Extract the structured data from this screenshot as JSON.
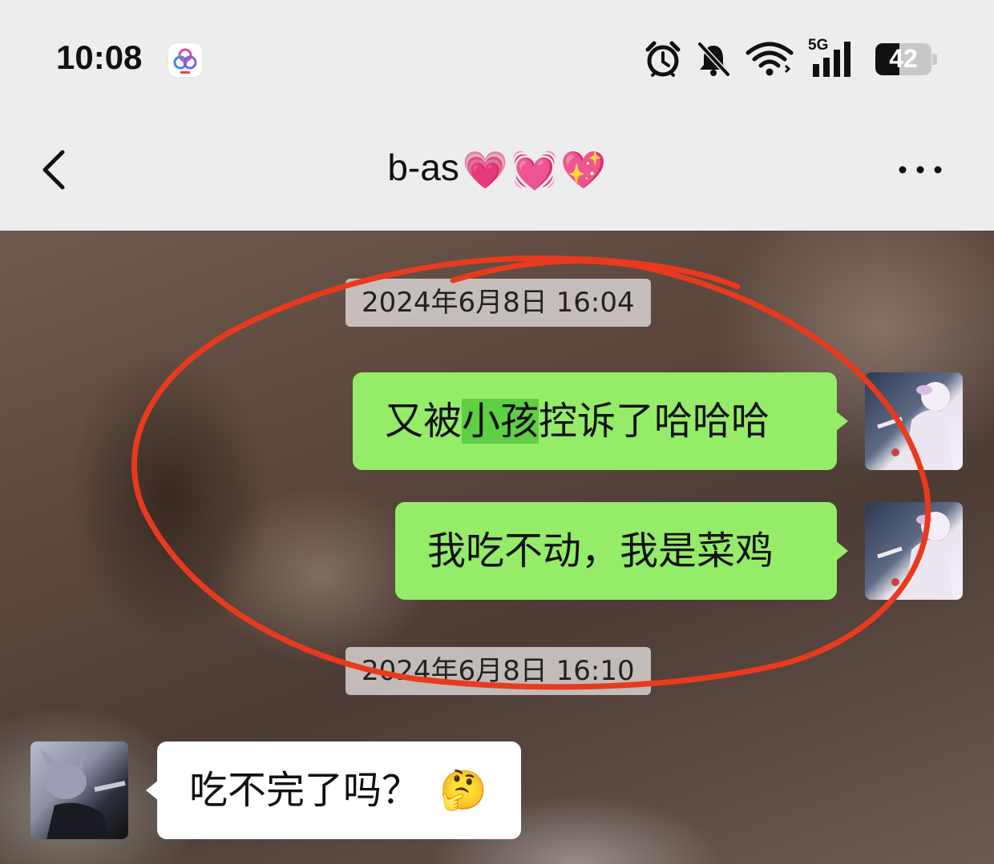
{
  "status_bar": {
    "time": "10:08",
    "app_icon": "multi-circle-app-icon",
    "icons": [
      "alarm-icon",
      "bell-off-icon",
      "wifi-icon",
      "cellular-5g-icon"
    ],
    "network_label": "5G",
    "battery_level": "42"
  },
  "header": {
    "back_icon": "chevron-left-icon",
    "title": "b-as",
    "title_emojis": [
      "💗",
      "💓",
      "💖"
    ],
    "more_icon": "more-dots-icon"
  },
  "messages": [
    {
      "type": "time",
      "text": "2024年6月8日 16:04"
    },
    {
      "type": "outgoing",
      "parts": [
        "又被",
        "小孩",
        "控诉了哈哈哈"
      ],
      "highlighted": "小孩"
    },
    {
      "type": "outgoing",
      "text": "我吃不动，我是菜鸡"
    },
    {
      "type": "time",
      "text": "2024年6月8日 16:10"
    },
    {
      "type": "incoming",
      "text": "吃不完了吗？",
      "emoji": "🤔"
    }
  ],
  "colors": {
    "outgoing_bubble": "#95ec69",
    "highlight": "#5fcf45",
    "incoming_bubble": "#ffffff",
    "annotation_circle": "#e83a1e"
  }
}
